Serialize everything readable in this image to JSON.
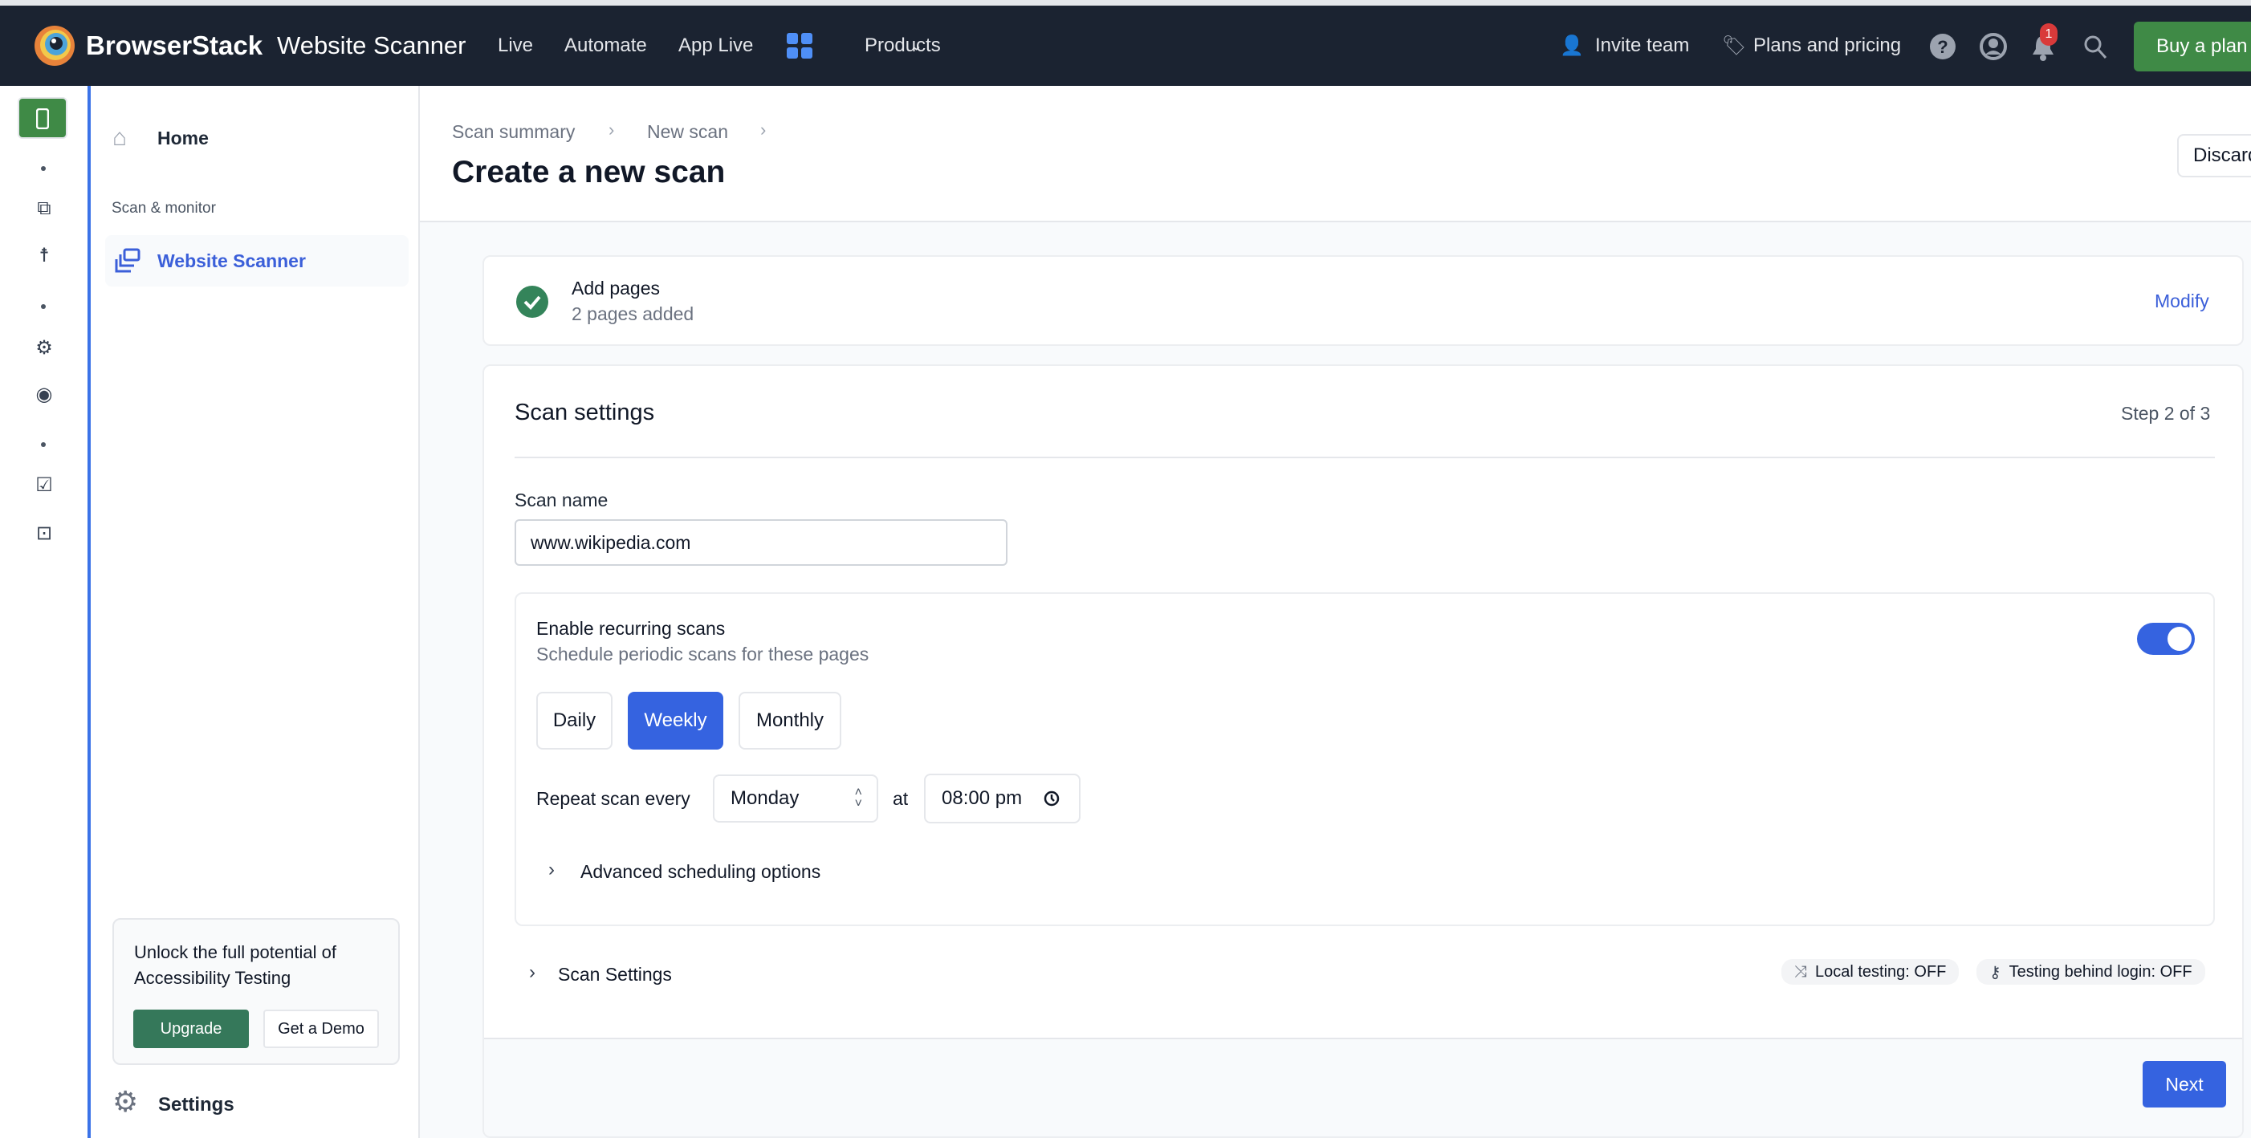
{
  "navbar": {
    "brand": "BrowserStack",
    "product": "Website Scanner",
    "links": [
      "Live",
      "Automate",
      "App Live"
    ],
    "products_label": "Products",
    "invite_label": "Invite team",
    "plans_label": "Plans and pricing",
    "notification_count": "1",
    "buy_label": "Buy a plan"
  },
  "sidebar": {
    "home": "Home",
    "section": "Scan & monitor",
    "active_item": "Website Scanner",
    "promo_text": "Unlock the full potential of Accessibility Testing",
    "upgrade": "Upgrade",
    "demo": "Get a Demo",
    "settings": "Settings"
  },
  "header": {
    "breadcrumb": [
      "Scan summary",
      "New scan"
    ],
    "title": "Create a new scan",
    "discard": "Discard"
  },
  "add_pages": {
    "title": "Add pages",
    "subtitle": "2 pages added",
    "modify": "Modify"
  },
  "scan_settings": {
    "title": "Scan settings",
    "step": "Step 2 of 3",
    "name_label": "Scan name",
    "name_value": "www.wikipedia.com",
    "recurring": {
      "title": "Enable recurring scans",
      "subtitle": "Schedule periodic scans for these pages",
      "enabled": true,
      "frequencies": [
        "Daily",
        "Weekly",
        "Monthly"
      ],
      "selected": "Weekly",
      "repeat_label": "Repeat scan every",
      "day": "Monday",
      "at": "at",
      "time": "08:00 pm",
      "advanced": "Advanced scheduling options"
    },
    "more_settings": "Scan Settings",
    "local_testing": "Local testing: OFF",
    "login_testing": "Testing behind login: OFF",
    "next": "Next"
  },
  "colors": {
    "navbar": "#1b2331",
    "primary": "#3563e0",
    "green": "#3f8a46",
    "link": "#3b5fd9"
  }
}
